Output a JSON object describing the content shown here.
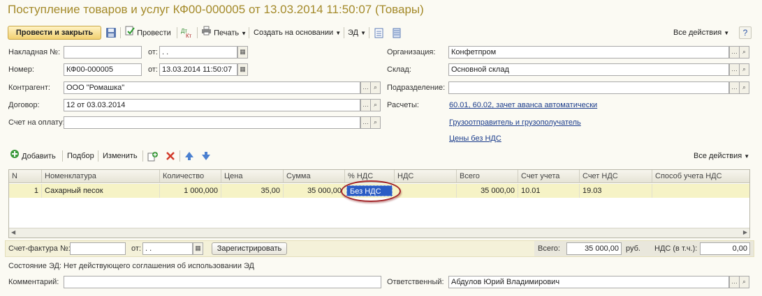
{
  "title": "Поступление товаров и услуг КФ00-000005 от 13.03.2014 11:50:07 (Товары)",
  "toolbar": {
    "post_and_close": "Провести и закрыть",
    "post": "Провести",
    "print": "Печать",
    "create_based_on": "Создать на основании",
    "ed": "ЭД",
    "all_actions": "Все действия"
  },
  "form": {
    "invoice_no_label": "Накладная №:",
    "invoice_no_value": "",
    "from_label": "от:",
    "invoice_date_value": " .  .",
    "number_label": "Номер:",
    "number_value": "КФ00-000005",
    "date_value": "13.03.2014 11:50:07",
    "counterparty_label": "Контрагент:",
    "counterparty_value": "ООО \"Ромашка\"",
    "contract_label": "Договор:",
    "contract_value": "12 от 03.03.2014",
    "payment_account_label": "Счет на оплату:",
    "payment_account_value": "",
    "org_label": "Организация:",
    "org_value": "Конфетпром",
    "warehouse_label": "Склад:",
    "warehouse_value": "Основной склад",
    "division_label": "Подразделение:",
    "division_value": "",
    "settlements_label": "Расчеты:",
    "settlements_link": "60.01, 60.02, зачет аванса автоматически",
    "shipper_link": "Грузоотправитель и грузополучатель",
    "prices_link": "Цены без НДС"
  },
  "table_toolbar": {
    "add": "Добавить",
    "select": "Подбор",
    "change": "Изменить",
    "all_actions": "Все действия"
  },
  "table": {
    "columns": [
      "N",
      "Номенклатура",
      "Количество",
      "Цена",
      "Сумма",
      "% НДС",
      "НДС",
      "Всего",
      "Счет учета",
      "Счет НДС",
      "Способ учета НДС"
    ],
    "rows": [
      [
        "1",
        "Сахарный песок",
        "1 000,000",
        "35,00",
        "35 000,00",
        "Без НДС",
        "",
        "35 000,00",
        "10.01",
        "19.03",
        ""
      ]
    ]
  },
  "bottom": {
    "invoice_label": "Счет-фактура №:",
    "invoice_value": "",
    "from_label": "от:",
    "invoice_date_value": " .  .",
    "register_button": "Зарегистрировать",
    "total_label": "Всего:",
    "total_value": "35 000,00",
    "currency": "руб.",
    "vat_label": "НДС (в т.ч.):",
    "vat_value": "0,00"
  },
  "ed_status": "Состояние ЭД: Нет действующего соглашения об использовании ЭД",
  "comment_label": "Комментарий:",
  "comment_value": "",
  "responsible_label": "Ответственный:",
  "responsible_value": "Абдулов Юрий Владимирович",
  "colors": {
    "title": "#a48a2a",
    "selected_row": "#f6f3c6",
    "highlight_cell": "#2a5cc4",
    "circle": "#a3262a"
  }
}
